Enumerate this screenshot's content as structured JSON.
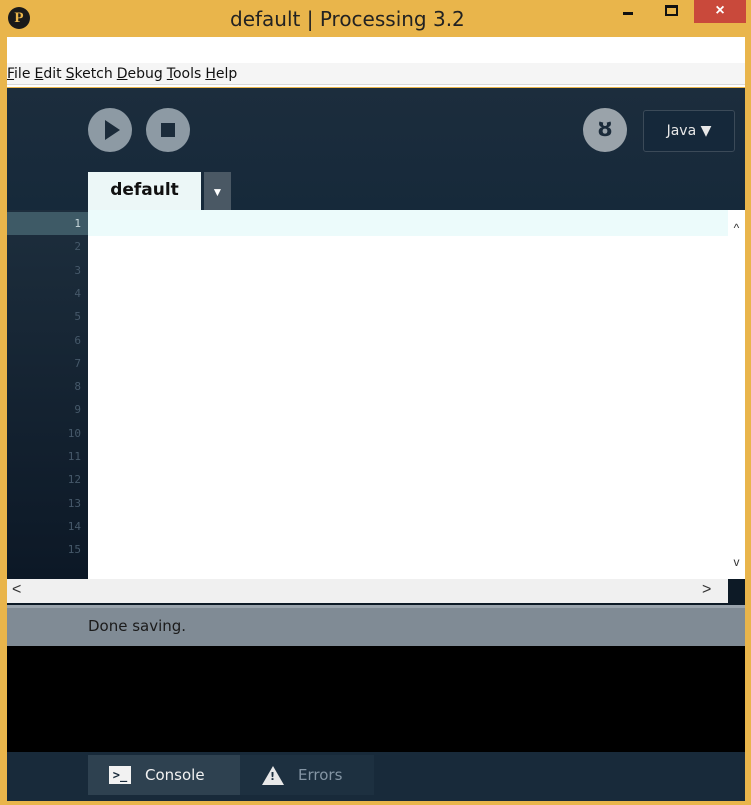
{
  "window": {
    "title": "default | Processing 3.2",
    "app_icon": "processing-p-icon",
    "close_glyph": "×"
  },
  "menu": {
    "items": [
      {
        "underline": "F",
        "rest": "ile"
      },
      {
        "underline": "E",
        "rest": "dit"
      },
      {
        "underline": "S",
        "rest": "ketch"
      },
      {
        "underline": "D",
        "rest": "ebug"
      },
      {
        "underline": "T",
        "rest": "ools"
      },
      {
        "underline": "H",
        "rest": "elp"
      }
    ]
  },
  "toolbar": {
    "run_icon": "play-icon",
    "stop_icon": "stop-icon",
    "debug_glyph": "ȣ",
    "mode_label": "Java ▼"
  },
  "editor": {
    "tab_label": "default",
    "tab_menu_glyph": "▼",
    "line_numbers": [
      "1",
      "2",
      "3",
      "4",
      "5",
      "6",
      "7",
      "8",
      "9",
      "10",
      "11",
      "12",
      "13",
      "14",
      "15"
    ],
    "current_line": "1",
    "scroll_up": "^",
    "scroll_down": "v",
    "scroll_left": "<",
    "scroll_right": ">"
  },
  "status": {
    "message": "Done saving."
  },
  "bottom_tabs": {
    "console_label": "Console",
    "console_icon_glyph": ">_",
    "errors_label": "Errors",
    "errors_icon_glyph": "!"
  },
  "colors": {
    "frame": "#e9b54b",
    "editor_background": "#0d1a26",
    "close_button": "#c9493b",
    "current_line": "#ecfbfb"
  }
}
